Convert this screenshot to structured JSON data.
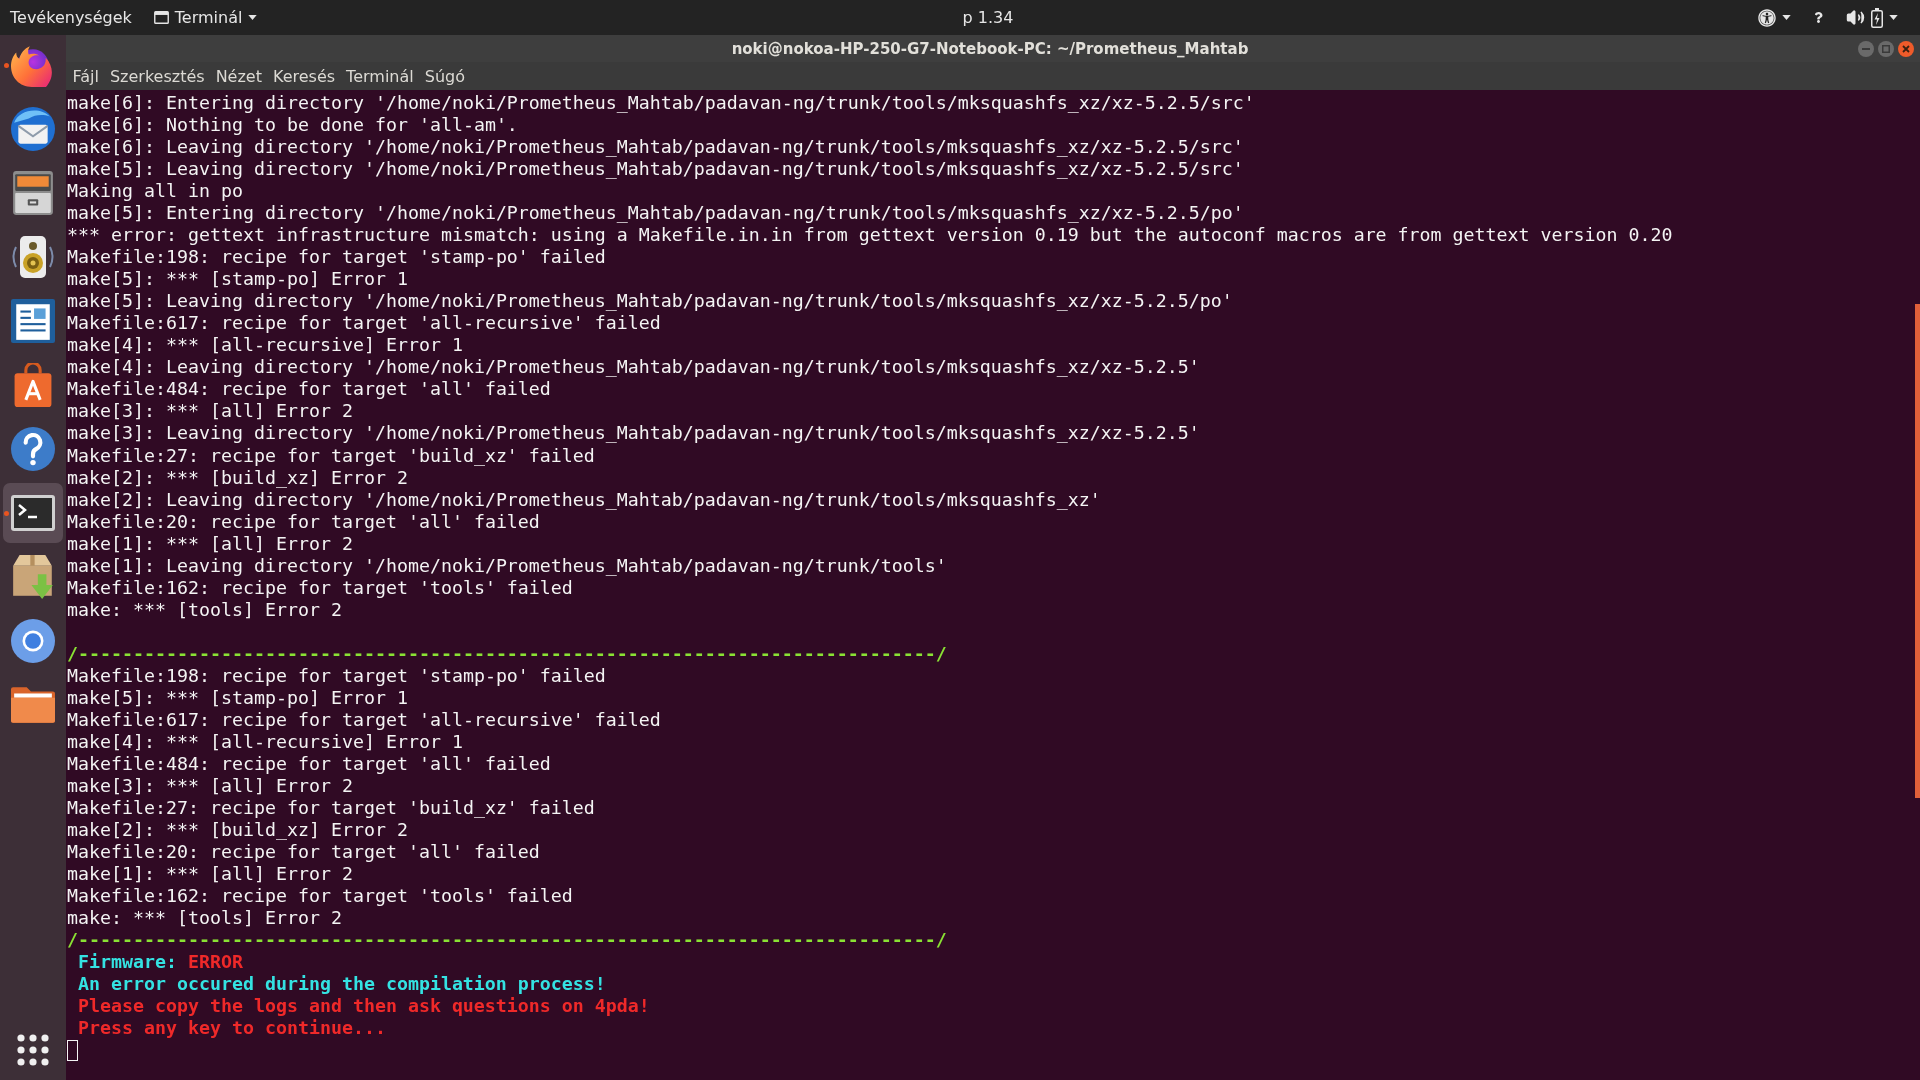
{
  "top_bar": {
    "activities": "Tevékenységek",
    "app_menu": "Terminál",
    "clock": "p 1.34"
  },
  "dock": {
    "items": [
      {
        "running": true,
        "selected": false
      },
      {
        "running": false,
        "selected": false
      },
      {
        "running": false,
        "selected": false
      },
      {
        "running": false,
        "selected": false
      },
      {
        "running": false,
        "selected": false
      },
      {
        "running": false,
        "selected": false
      },
      {
        "running": false,
        "selected": false
      },
      {
        "running": true,
        "selected": true
      },
      {
        "running": false,
        "selected": false
      },
      {
        "running": false,
        "selected": false
      },
      {
        "running": false,
        "selected": false
      }
    ]
  },
  "window": {
    "title": "noki@nokoa-HP-250-G7-Notebook-PC: ~/Prometheus_Mahtab",
    "menu": [
      "Fájl",
      "Szerkesztés",
      "Nézet",
      "Keresés",
      "Terminál",
      "Súgó"
    ]
  },
  "terminal": {
    "lines": [
      {
        "kind": "output",
        "text": "make[6]: Entering directory '/home/noki/Prometheus_Mahtab/padavan-ng/trunk/tools/mksquashfs_xz/xz-5.2.5/src'"
      },
      {
        "kind": "output",
        "text": "make[6]: Nothing to be done for 'all-am'."
      },
      {
        "kind": "output",
        "text": "make[6]: Leaving directory '/home/noki/Prometheus_Mahtab/padavan-ng/trunk/tools/mksquashfs_xz/xz-5.2.5/src'"
      },
      {
        "kind": "output",
        "text": "make[5]: Leaving directory '/home/noki/Prometheus_Mahtab/padavan-ng/trunk/tools/mksquashfs_xz/xz-5.2.5/src'"
      },
      {
        "kind": "output",
        "text": "Making all in po"
      },
      {
        "kind": "output",
        "text": "make[5]: Entering directory '/home/noki/Prometheus_Mahtab/padavan-ng/trunk/tools/mksquashfs_xz/xz-5.2.5/po'"
      },
      {
        "kind": "output",
        "text": "*** error: gettext infrastructure mismatch: using a Makefile.in.in from gettext version 0.19 but the autoconf macros are from gettext version 0.20"
      },
      {
        "kind": "output",
        "text": "Makefile:198: recipe for target 'stamp-po' failed"
      },
      {
        "kind": "output",
        "text": "make[5]: *** [stamp-po] Error 1"
      },
      {
        "kind": "output",
        "text": "make[5]: Leaving directory '/home/noki/Prometheus_Mahtab/padavan-ng/trunk/tools/mksquashfs_xz/xz-5.2.5/po'"
      },
      {
        "kind": "output",
        "text": "Makefile:617: recipe for target 'all-recursive' failed"
      },
      {
        "kind": "output",
        "text": "make[4]: *** [all-recursive] Error 1"
      },
      {
        "kind": "output",
        "text": "make[4]: Leaving directory '/home/noki/Prometheus_Mahtab/padavan-ng/trunk/tools/mksquashfs_xz/xz-5.2.5'"
      },
      {
        "kind": "output",
        "text": "Makefile:484: recipe for target 'all' failed"
      },
      {
        "kind": "output",
        "text": "make[3]: *** [all] Error 2"
      },
      {
        "kind": "output",
        "text": "make[3]: Leaving directory '/home/noki/Prometheus_Mahtab/padavan-ng/trunk/tools/mksquashfs_xz/xz-5.2.5'"
      },
      {
        "kind": "output",
        "text": "Makefile:27: recipe for target 'build_xz' failed"
      },
      {
        "kind": "output",
        "text": "make[2]: *** [build_xz] Error 2"
      },
      {
        "kind": "output",
        "text": "make[2]: Leaving directory '/home/noki/Prometheus_Mahtab/padavan-ng/trunk/tools/mksquashfs_xz'"
      },
      {
        "kind": "output",
        "text": "Makefile:20: recipe for target 'all' failed"
      },
      {
        "kind": "output",
        "text": "make[1]: *** [all] Error 2"
      },
      {
        "kind": "output",
        "text": "make[1]: Leaving directory '/home/noki/Prometheus_Mahtab/padavan-ng/trunk/tools'"
      },
      {
        "kind": "output",
        "text": "Makefile:162: recipe for target 'tools' failed"
      },
      {
        "kind": "output",
        "text": "make: *** [tools] Error 2"
      },
      {
        "kind": "blank"
      },
      {
        "kind": "separator",
        "text": "/------------------------------------------------------------------------------/"
      },
      {
        "kind": "output",
        "text": "Makefile:198: recipe for target 'stamp-po' failed"
      },
      {
        "kind": "output",
        "text": "make[5]: *** [stamp-po] Error 1"
      },
      {
        "kind": "output",
        "text": "Makefile:617: recipe for target 'all-recursive' failed"
      },
      {
        "kind": "output",
        "text": "make[4]: *** [all-recursive] Error 1"
      },
      {
        "kind": "output",
        "text": "Makefile:484: recipe for target 'all' failed"
      },
      {
        "kind": "output",
        "text": "make[3]: *** [all] Error 2"
      },
      {
        "kind": "output",
        "text": "Makefile:27: recipe for target 'build_xz' failed"
      },
      {
        "kind": "output",
        "text": "make[2]: *** [build_xz] Error 2"
      },
      {
        "kind": "output",
        "text": "Makefile:20: recipe for target 'all' failed"
      },
      {
        "kind": "output",
        "text": "make[1]: *** [all] Error 2"
      },
      {
        "kind": "output",
        "text": "Makefile:162: recipe for target 'tools' failed"
      },
      {
        "kind": "output",
        "text": "make: *** [tools] Error 2"
      },
      {
        "kind": "separator",
        "text": "/------------------------------------------------------------------------------/"
      },
      {
        "kind": "status",
        "label": "Firmware:",
        "value": "ERROR"
      },
      {
        "kind": "notice",
        "text": "An error occured during the compilation process!"
      },
      {
        "kind": "alert",
        "text": "Please copy the logs and then ask questions on 4pda!"
      },
      {
        "kind": "alert",
        "text": "Press any key to continue..."
      }
    ]
  }
}
